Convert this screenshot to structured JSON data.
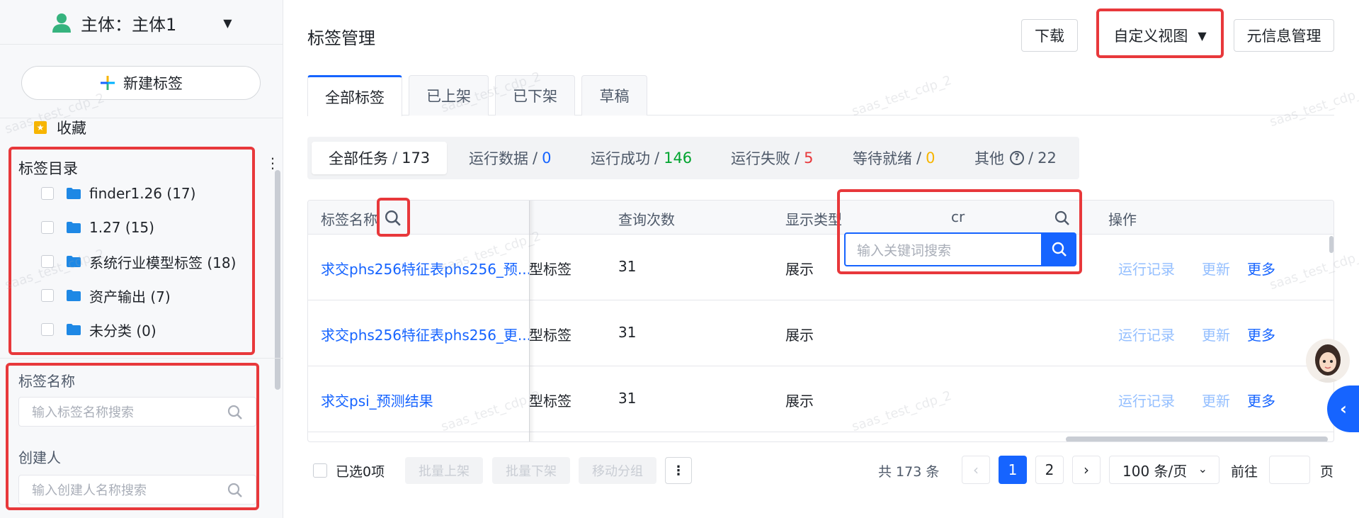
{
  "sidebar": {
    "subject_label": "主体：主体1",
    "new_tag_label": "新建标签",
    "favorites_label": "收藏",
    "catalog_title": "标签目录",
    "tree_items": [
      {
        "label": "finder1.26 (17)"
      },
      {
        "label": "1.27 (15)"
      },
      {
        "label": "系统行业模型标签 (18)"
      },
      {
        "label": "资产输出 (7)"
      },
      {
        "label": "未分类 (0)"
      }
    ],
    "filters": [
      {
        "label": "标签名称",
        "placeholder": "输入标签名称搜索"
      },
      {
        "label": "创建人",
        "placeholder": "输入创建人名称搜索"
      }
    ]
  },
  "header": {
    "title": "标签管理",
    "download_label": "下载",
    "custom_view_label": "自定义视图",
    "meta_manage_label": "元信息管理"
  },
  "tabs": [
    {
      "label": "全部标签",
      "active": true
    },
    {
      "label": "已上架",
      "active": false
    },
    {
      "label": "已下架",
      "active": false
    },
    {
      "label": "草稿",
      "active": false
    }
  ],
  "status_filters": [
    {
      "label": "全部任务",
      "count": "173",
      "color": "#1f2329"
    },
    {
      "label": "运行数据",
      "count": "0",
      "color": "#1664ff"
    },
    {
      "label": "运行成功",
      "count": "146",
      "color": "#00a42e"
    },
    {
      "label": "运行失败",
      "count": "5",
      "color": "#e8383b"
    },
    {
      "label": "等待就绪",
      "count": "0",
      "color": "#f7b500"
    },
    {
      "label": "其他",
      "count": "22",
      "color": "#1f2329"
    }
  ],
  "table": {
    "columns": {
      "name": "标签名称",
      "query_count": "查询次数",
      "display_type": "显示类型",
      "filter_value": "cr",
      "actions": "操作"
    },
    "rows": [
      {
        "name": "求交phs256特征表phs256_预...",
        "type_tail": "型标签",
        "query_count": "31",
        "display_type": "展示"
      },
      {
        "name": "求交phs256特征表phs256_更...",
        "type_tail": "型标签",
        "query_count": "31",
        "display_type": "展示"
      },
      {
        "name": "求交psi_预测结果",
        "type_tail": "型标签",
        "query_count": "31",
        "display_type": "展示"
      }
    ],
    "row_actions": {
      "run_log": "运行记录",
      "update": "更新",
      "more": "更多"
    },
    "search_placeholder": "输入关键词搜索"
  },
  "footer": {
    "selected_label": "已选0项",
    "batch_up_label": "批量上架",
    "batch_down_label": "批量下架",
    "move_group_label": "移动分组",
    "total_label": "共 173 条",
    "pages": [
      "1",
      "2"
    ],
    "page_size_label": "100 条/页",
    "goto_label": "前往",
    "page_unit_label": "页"
  },
  "watermark_text": "saas_test_cdp_2"
}
